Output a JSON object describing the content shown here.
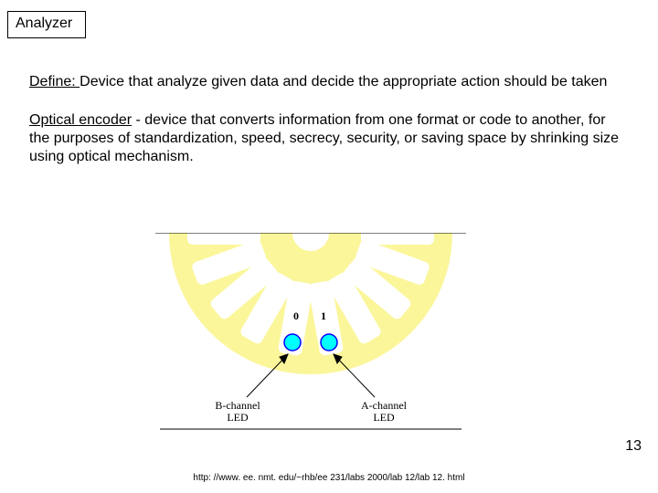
{
  "title": "Analyzer",
  "para1_label": "Define: ",
  "para1_text": "Device that analyze given data and decide the appropriate action should be taken",
  "para2_label": "Optical encoder",
  "para2_text": " - device that converts information from one format or code to another, for the purposes of standardization, speed, secrecy, security, or saving space by shrinking size using optical mechanism.",
  "encoder": {
    "bit0": "0",
    "bit1": "1",
    "b_channel_l1": "B-channel",
    "b_channel_l2": "LED",
    "a_channel_l1": "A-channel",
    "a_channel_l2": "LED"
  },
  "colors": {
    "disc": "#fbf69a",
    "led_fill": "#00ffff",
    "led_stroke": "#0000ff"
  },
  "page_number": "13",
  "footer_url": "http: //www. ee. nmt. edu/~rhb/ee 231/labs 2000/lab 12/lab 12. html"
}
